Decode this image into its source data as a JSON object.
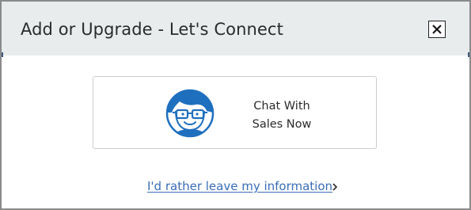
{
  "dialog": {
    "title": "Add or Upgrade - Let's Connect",
    "close_icon": "close-x-icon"
  },
  "chat_card": {
    "line1": "Chat With",
    "line2": "Sales Now",
    "avatar_icon": "sales-agent-avatar-icon"
  },
  "info_link": {
    "label": "I'd rather leave my information",
    "chevron_icon": "chevron-right-icon"
  },
  "colors": {
    "header_bg": "#e8ecec",
    "link": "#3a6db8",
    "avatar_blue": "#1f6fbf",
    "card_border": "#c9ced2"
  }
}
